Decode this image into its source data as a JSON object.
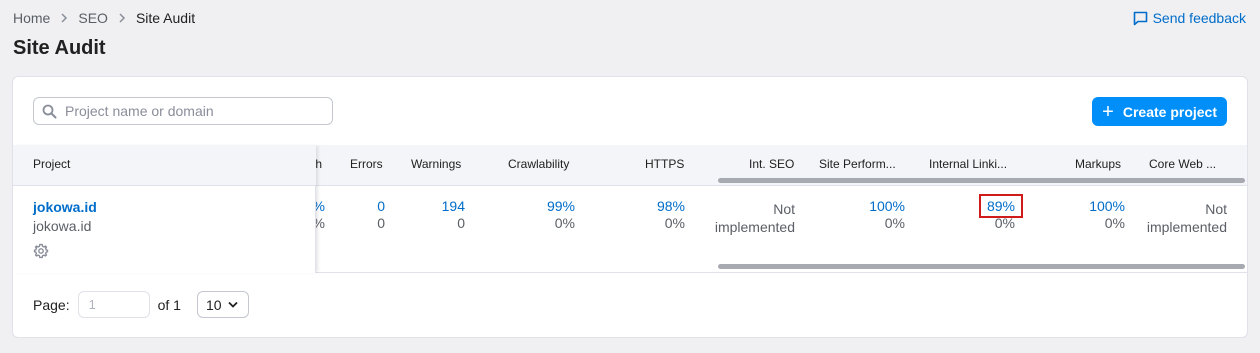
{
  "breadcrumb": {
    "items": [
      "Home",
      "SEO",
      "Site Audit"
    ]
  },
  "feedback": {
    "label": "Send feedback",
    "icon": "feedback-icon"
  },
  "page": {
    "title": "Site Audit"
  },
  "search": {
    "placeholder": "Project name or domain",
    "value": "",
    "icon": "search-icon"
  },
  "create_button": {
    "label": "Create project",
    "icon": "plus-icon"
  },
  "table": {
    "project_header": "Project",
    "columns": [
      "th",
      "Errors",
      "Warnings",
      "Crawlability",
      "HTTPS",
      "Int. SEO",
      "Site Perform...",
      "Internal Linki...",
      "Markups",
      "Core Web ..."
    ],
    "row": {
      "project_name": "jokowa.id",
      "project_domain": "jokowa.id",
      "settings_icon": "gear-icon",
      "cells": [
        {
          "value": "%",
          "delta": "%"
        },
        {
          "value": "0",
          "delta": "0"
        },
        {
          "value": "194",
          "delta": "0"
        },
        {
          "value": "99%",
          "delta": "0%"
        },
        {
          "value": "98%",
          "delta": "0%"
        },
        {
          "line1": "Not",
          "line2": "implemented"
        },
        {
          "value": "100%",
          "delta": "0%"
        },
        {
          "value": "89%",
          "delta": "0%"
        },
        {
          "value": "100%",
          "delta": "0%"
        },
        {
          "line1": "Not",
          "line2": "implemented"
        }
      ]
    }
  },
  "pagination": {
    "page_label": "Page:",
    "page_value": "1",
    "of_label": "of 1",
    "page_size": "10"
  },
  "colors": {
    "accent": "#008ff8",
    "link": "#006dca",
    "highlight_box": "#d11a1a"
  }
}
